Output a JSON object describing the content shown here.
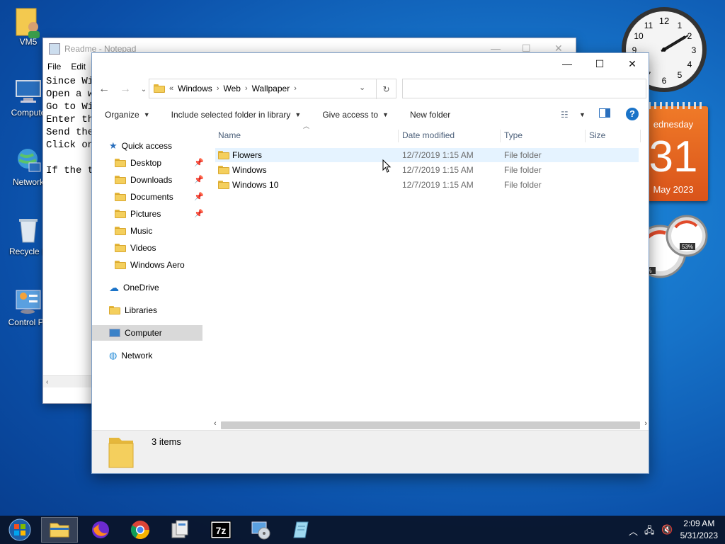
{
  "desktop": {
    "icons": [
      {
        "label": "VM5"
      },
      {
        "label": "Compute"
      },
      {
        "label": "Network"
      },
      {
        "label": "Recycle B"
      },
      {
        "label": "Control Pa"
      }
    ]
  },
  "gadgets": {
    "calendar": {
      "day": "ednesday",
      "date": "31",
      "month": "May 2023"
    },
    "clock_numbers": [
      "12",
      "1",
      "2",
      "3",
      "4",
      "5",
      "6",
      "7",
      "8",
      "9",
      "10",
      "11"
    ],
    "meter": {
      "percent_a": "%",
      "percent_b": "53%"
    }
  },
  "notepad": {
    "title": "Readme - Notepad",
    "menu": [
      "File",
      "Edit"
    ],
    "lines": [
      "Since Wi",
      "Open a w",
      "Go to Wi",
      "Enter th",
      "Send the",
      "Click on",
      "",
      "If the t"
    ]
  },
  "explorer": {
    "controls": {
      "minimize": "—",
      "maximize": "☐",
      "close": "✕"
    },
    "address": {
      "prefix": "«",
      "crumbs": [
        "Windows",
        "Web",
        "Wallpaper"
      ]
    },
    "search_placeholder": "",
    "toolbar": {
      "organize": "Organize",
      "include": "Include selected folder in library",
      "give_access": "Give access to",
      "new_folder": "New folder"
    },
    "nav": {
      "quick_access": "Quick access",
      "quick_items": [
        {
          "label": "Desktop",
          "pinned": true
        },
        {
          "label": "Downloads",
          "pinned": true
        },
        {
          "label": "Documents",
          "pinned": true
        },
        {
          "label": "Pictures",
          "pinned": true
        },
        {
          "label": "Music",
          "pinned": false
        },
        {
          "label": "Videos",
          "pinned": false
        },
        {
          "label": "Windows Aero",
          "pinned": false
        }
      ],
      "onedrive": "OneDrive",
      "libraries": "Libraries",
      "computer": "Computer",
      "network": "Network"
    },
    "columns": {
      "name": "Name",
      "date": "Date modified",
      "type": "Type",
      "size": "Size"
    },
    "rows": [
      {
        "name": "Flowers",
        "date": "12/7/2019 1:15 AM",
        "type": "File folder"
      },
      {
        "name": "Windows",
        "date": "12/7/2019 1:15 AM",
        "type": "File folder"
      },
      {
        "name": "Windows 10",
        "date": "12/7/2019 1:15 AM",
        "type": "File folder"
      }
    ],
    "status": {
      "count": "3 items"
    }
  },
  "taskbar": {
    "time": "2:09 AM",
    "date": "5/31/2023",
    "apps": [
      "start-orb",
      "file-explorer",
      "firefox",
      "chrome",
      "control-panel",
      "7zip",
      "disk-tool",
      "notepad"
    ]
  }
}
